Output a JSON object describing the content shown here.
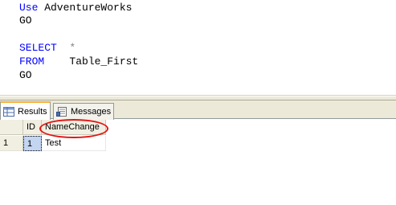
{
  "editor": {
    "lines": [
      {
        "kw": "Use",
        "rest": " AdventureWorks"
      },
      {
        "kw": "",
        "rest": "GO"
      },
      {
        "kw": "",
        "rest": ""
      },
      {
        "kw": "SELECT",
        "op": "*"
      },
      {
        "kw": "FROM",
        "rest": "   Table_First"
      },
      {
        "kw": "",
        "rest": "GO"
      }
    ],
    "line0_kw": "Use",
    "line0_rest": " AdventureWorks",
    "line1": "GO",
    "line3_kw": "SELECT",
    "line3_op": "  *",
    "line4_kw": "FROM",
    "line4_rest": "    Table_First",
    "line5": "GO"
  },
  "tabs": {
    "results_label": "Results",
    "messages_label": "Messages"
  },
  "grid": {
    "columns": [
      "ID",
      "NameChange"
    ],
    "rows": [
      {
        "row_number": "1",
        "ID": "1",
        "NameChange": "Test"
      }
    ]
  },
  "annotation": {
    "color": "#e11515"
  }
}
